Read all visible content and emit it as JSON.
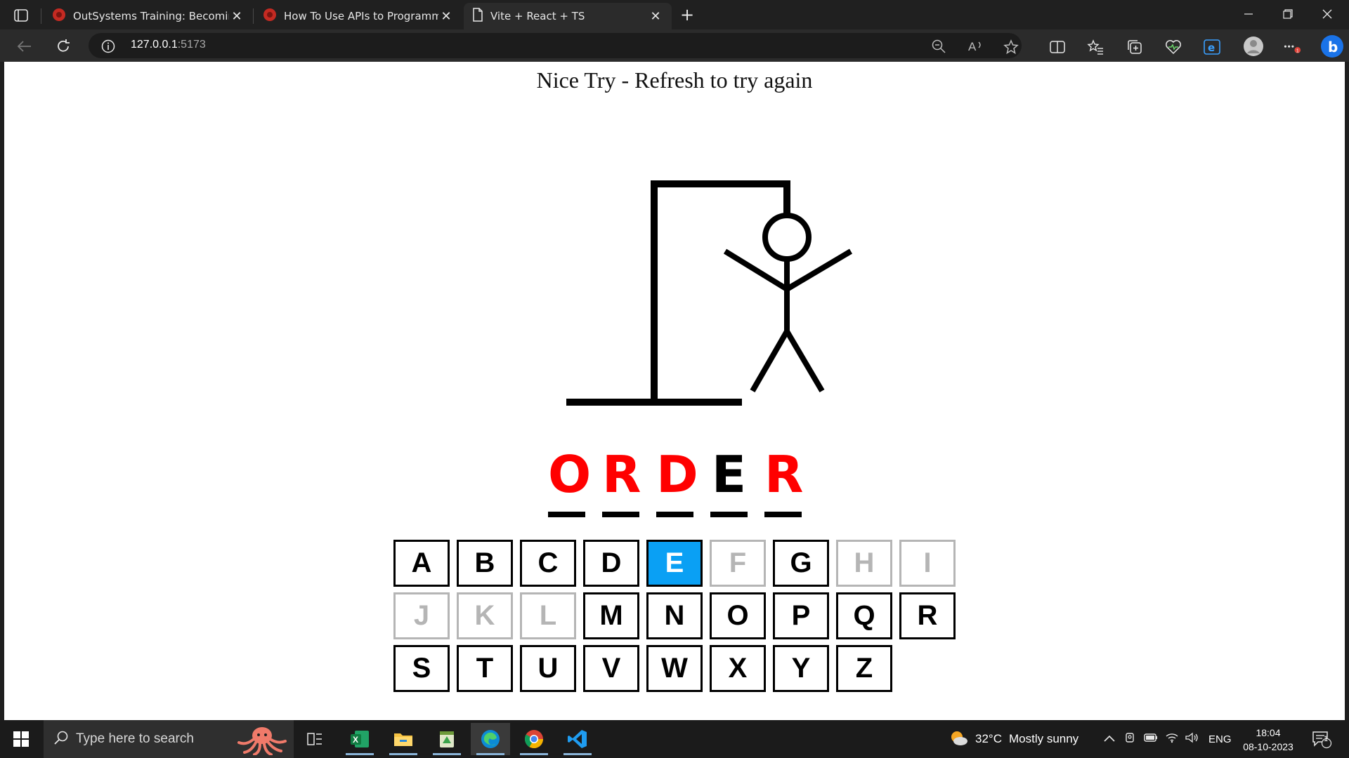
{
  "browser": {
    "tabs": [
      {
        "title": "OutSystems Training: Becoming a",
        "icon": "outsystems-icon",
        "active": false
      },
      {
        "title": "How To Use APIs to Programmat",
        "icon": "outsystems-icon",
        "active": false
      },
      {
        "title": "Vite + React + TS",
        "icon": "document-icon",
        "active": true
      }
    ],
    "new_tab_label": "+",
    "url_host": "127.0.0.1",
    "url_port": ":5173"
  },
  "game": {
    "status_message": "Nice Try - Refresh to try again",
    "word": [
      {
        "letter": "O",
        "state": "missed"
      },
      {
        "letter": "R",
        "state": "missed"
      },
      {
        "letter": "D",
        "state": "missed"
      },
      {
        "letter": "E",
        "state": "guessed"
      },
      {
        "letter": "R",
        "state": "missed"
      }
    ],
    "keys": [
      {
        "letter": "A",
        "state": "available"
      },
      {
        "letter": "B",
        "state": "available"
      },
      {
        "letter": "C",
        "state": "available"
      },
      {
        "letter": "D",
        "state": "available"
      },
      {
        "letter": "E",
        "state": "active"
      },
      {
        "letter": "F",
        "state": "disabled"
      },
      {
        "letter": "G",
        "state": "available"
      },
      {
        "letter": "H",
        "state": "disabled"
      },
      {
        "letter": "I",
        "state": "disabled"
      },
      {
        "letter": "J",
        "state": "disabled"
      },
      {
        "letter": "K",
        "state": "disabled"
      },
      {
        "letter": "L",
        "state": "disabled"
      },
      {
        "letter": "M",
        "state": "available"
      },
      {
        "letter": "N",
        "state": "available"
      },
      {
        "letter": "O",
        "state": "available"
      },
      {
        "letter": "P",
        "state": "available"
      },
      {
        "letter": "Q",
        "state": "available"
      },
      {
        "letter": "R",
        "state": "available"
      },
      {
        "letter": "S",
        "state": "available"
      },
      {
        "letter": "T",
        "state": "available"
      },
      {
        "letter": "U",
        "state": "available"
      },
      {
        "letter": "V",
        "state": "available"
      },
      {
        "letter": "W",
        "state": "available"
      },
      {
        "letter": "X",
        "state": "available"
      },
      {
        "letter": "Y",
        "state": "available"
      },
      {
        "letter": "Z",
        "state": "available"
      }
    ],
    "colors": {
      "missed": "#ff0000",
      "active_key": "#0aa0f4",
      "disabled_key": "#b5b5b5"
    }
  },
  "taskbar": {
    "search_placeholder": "Type here to search",
    "weather_temp": "32°C",
    "weather_text": "Mostly sunny",
    "language": "ENG",
    "time": "18:04",
    "date": "08-10-2023",
    "notification_count": "1",
    "apps": [
      "task-view-icon",
      "excel-icon",
      "file-explorer-icon",
      "notepad-icon",
      "edge-icon",
      "chrome-icon",
      "vscode-icon"
    ]
  }
}
